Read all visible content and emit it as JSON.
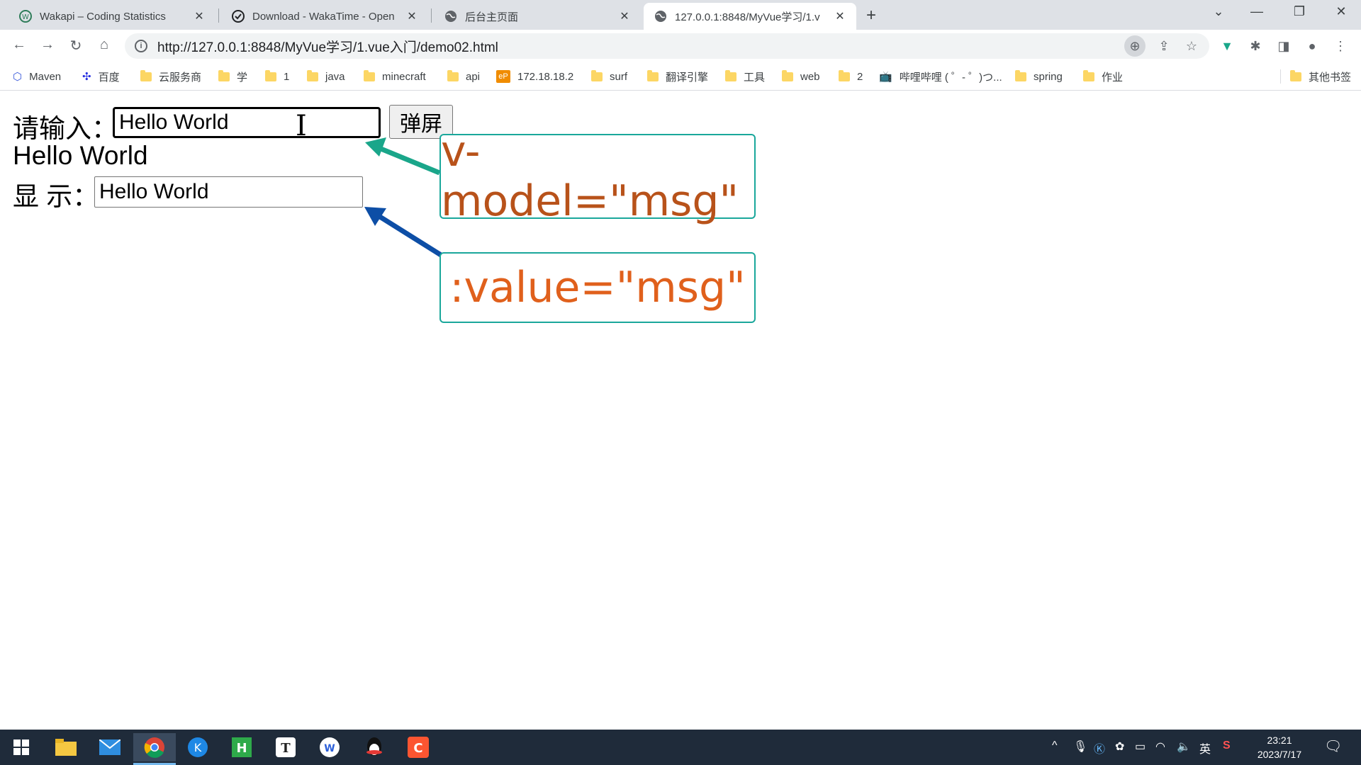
{
  "browser": {
    "tabs": [
      {
        "title": "Wakapi – Coding Statistics",
        "icon": "wakapi-icon"
      },
      {
        "title": "Download - WakaTime - Open",
        "icon": "check-circle-icon"
      },
      {
        "title": "后台主页面",
        "icon": "globe-icon"
      },
      {
        "title": "127.0.0.1:8848/MyVue学习/1.v",
        "icon": "globe-icon"
      }
    ],
    "url": "http://127.0.0.1:8848/MyVue学习/1.vue入门/demo02.html",
    "bookmarks": [
      {
        "label": "Maven",
        "icon": "maven-icon"
      },
      {
        "label": "百度",
        "icon": "baidu-icon"
      },
      {
        "label": "云服务商",
        "icon": "folder-icon"
      },
      {
        "label": "学",
        "icon": "folder-icon"
      },
      {
        "label": "1",
        "icon": "folder-icon"
      },
      {
        "label": "java",
        "icon": "folder-icon"
      },
      {
        "label": "minecraft",
        "icon": "folder-icon"
      },
      {
        "label": "api",
        "icon": "folder-icon"
      },
      {
        "label": "172.18.18.2",
        "icon": "ep-icon"
      },
      {
        "label": "surf",
        "icon": "folder-icon"
      },
      {
        "label": "翻译引擎",
        "icon": "folder-icon"
      },
      {
        "label": "工具",
        "icon": "folder-icon"
      },
      {
        "label": "web",
        "icon": "folder-icon"
      },
      {
        "label": "2",
        "icon": "folder-icon"
      },
      {
        "label": "哔哩哔哩 ( ゜- ゜)つ...",
        "icon": "bilibili-icon"
      },
      {
        "label": "spring",
        "icon": "folder-icon"
      },
      {
        "label": "作业",
        "icon": "folder-icon"
      },
      {
        "label": "其他书签",
        "icon": "folder-icon"
      }
    ]
  },
  "page": {
    "input_label": "请输入：",
    "input_value": "Hello World",
    "button_label": "弹屏",
    "display_text": "Hello World",
    "display_label": "显 示：",
    "display_value": "Hello World"
  },
  "annotations": {
    "vmodel": {
      "text": "v-model=\"msg\"",
      "text_color": "#b8521a",
      "arrow_color": "#1aa68a"
    },
    "value": {
      "text": ":value=\"msg\"",
      "text_color": "#e0601c",
      "arrow_color": "#0d4ea6"
    }
  },
  "taskbar": {
    "apps": [
      "windows-start-icon",
      "file-explorer-icon",
      "mail-icon",
      "chrome-icon",
      "kugou-icon",
      "hbuilder-icon",
      "typora-icon",
      "wps-icon",
      "qq-icon",
      "csdn-icon"
    ],
    "time": "23:21",
    "date": "2023/7/17",
    "ime": "英"
  }
}
